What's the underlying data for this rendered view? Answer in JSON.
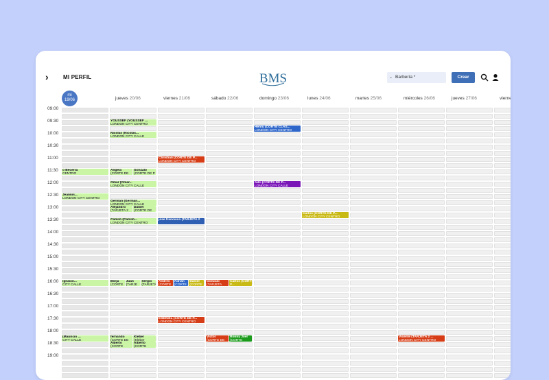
{
  "header": {
    "menu_label": "MI PERFIL",
    "logo_text": "BMS",
    "location_select": "Barbería *",
    "create_button": "Crear"
  },
  "days": [
    {
      "name": "mi",
      "date": "19/06",
      "today": true
    },
    {
      "name": "jueves",
      "date": "20/06"
    },
    {
      "name": "viernes",
      "date": "21/06"
    },
    {
      "name": "sábado",
      "date": "22/06"
    },
    {
      "name": "domingo",
      "date": "23/06"
    },
    {
      "name": "lunes",
      "date": "24/06"
    },
    {
      "name": "martes",
      "date": "25/06"
    },
    {
      "name": "miércoles",
      "date": "26/06"
    },
    {
      "name": "jueves",
      "date": "27/06"
    },
    {
      "name": "viernes",
      "date": ""
    }
  ],
  "times": [
    "09:00",
    "09:30",
    "10:00",
    "10:30",
    "11:00",
    "11:30",
    "12:00",
    "12:30",
    "13:00",
    "13:30",
    "14:00",
    "14:30",
    "15:00",
    "15:30",
    "16:00",
    "16:30",
    "17:00",
    "17:30",
    "18:00",
    "18:30",
    "19:00"
  ],
  "events": [
    {
      "day": 1,
      "slot": 2,
      "part": 0,
      "of": 1,
      "color": "g",
      "title": "YOUSSEF (YOUSSEF ...",
      "sub": "LONDON CITY CENTRO"
    },
    {
      "day": 1,
      "slot": 4,
      "part": 0,
      "of": 1,
      "color": "g",
      "title": "Nicolas (Nicolas...",
      "sub": "LONDON CITY CALLE"
    },
    {
      "day": 0,
      "slot": 10,
      "part": 0,
      "of": 1,
      "color": "g",
      "title": "o Becerra",
      "sub": "CENTRO"
    },
    {
      "day": 1,
      "slot": 10,
      "part": 0,
      "of": 2,
      "color": "g",
      "title": "Angela",
      "sub": "(CORTE DE"
    },
    {
      "day": 1,
      "slot": 10,
      "part": 1,
      "of": 2,
      "color": "g",
      "title": "Gonzalo",
      "sub": "(CORTE DE P"
    },
    {
      "day": 1,
      "slot": 12,
      "part": 0,
      "of": 1,
      "color": "g",
      "title": "Omar (Omar...",
      "sub": "LONDON CITY CALLE"
    },
    {
      "day": 0,
      "slot": 14,
      "part": 0,
      "of": 1,
      "color": "g",
      "title": "Jeannis...",
      "sub": "LONDON CITY CENTRO"
    },
    {
      "day": 1,
      "slot": 15,
      "part": 0,
      "of": 1,
      "color": "g",
      "title": "Germán (Germán...",
      "sub": "LONDON CITY CALLE"
    },
    {
      "day": 1,
      "slot": 16,
      "part": 0,
      "of": 2,
      "color": "g",
      "title": "Alejandro",
      "sub": "(TARJETA 2"
    },
    {
      "day": 1,
      "slot": 16,
      "part": 1,
      "of": 2,
      "color": "g",
      "title": "Daniel",
      "sub": "(CORTE DE"
    },
    {
      "day": 1,
      "slot": 18,
      "part": 0,
      "of": 1,
      "color": "g",
      "title": "Camilo (Camilo...",
      "sub": "LONDON CITY CENTRO"
    },
    {
      "day": 2,
      "slot": 8,
      "part": 0,
      "of": 1,
      "color": "r",
      "title": "Christian (CORTE DE P...",
      "sub": "LONDON CITY CENTRO"
    },
    {
      "day": 2,
      "slot": 18,
      "part": 0,
      "of": 1,
      "color": "b",
      "title": "jose francisco (TARJETA 2",
      "sub": ""
    },
    {
      "day": 4,
      "slot": 3,
      "part": 0,
      "of": 1,
      "color": "lb",
      "title": "Henry (CORTE CLAS...",
      "sub": "LONDON CITY CENTRO"
    },
    {
      "day": 4,
      "slot": 12,
      "part": 0,
      "of": 1,
      "color": "p",
      "title": "Adri (CORTE DE P...",
      "sub": "LONDON CITY CALLE"
    },
    {
      "day": 5,
      "slot": 17,
      "part": 0,
      "of": 1,
      "color": "y",
      "title": "Carlos (CORTE DE P...",
      "sub": "LONDON CITY CENTRO"
    },
    {
      "day": 0,
      "slot": 28,
      "part": 0,
      "of": 1,
      "color": "g",
      "title": "ignacio...",
      "sub": "CITY CALLE"
    },
    {
      "day": 1,
      "slot": 28,
      "part": 0,
      "of": 3,
      "color": "g",
      "title": "Borja",
      "sub": "(CORTE"
    },
    {
      "day": 1,
      "slot": 28,
      "part": 1,
      "of": 3,
      "color": "g",
      "title": "Juan",
      "sub": "(TARJE"
    },
    {
      "day": 1,
      "slot": 28,
      "part": 2,
      "of": 3,
      "color": "g",
      "title": "Sergio",
      "sub": "(TARJETA"
    },
    {
      "day": 2,
      "slot": 28,
      "part": 0,
      "of": 3,
      "color": "r",
      "title": "Andrés",
      "sub": "(CORTE"
    },
    {
      "day": 2,
      "slot": 28,
      "part": 1,
      "of": 3,
      "color": "lb",
      "title": "Adrián",
      "sub": "(CORTE"
    },
    {
      "day": 2,
      "slot": 28,
      "part": 2,
      "of": 3,
      "color": "y",
      "title": "Daniel",
      "sub": "(CORTE"
    },
    {
      "day": 3,
      "slot": 28,
      "part": 0,
      "of": 2,
      "color": "r",
      "title": "Gonzalo",
      "sub": "(TARJETA"
    },
    {
      "day": 3,
      "slot": 28,
      "part": 1,
      "of": 2,
      "color": "y",
      "title": "Carlos (CORTE DE",
      "sub": "P..."
    },
    {
      "day": 2,
      "slot": 34,
      "part": 0,
      "of": 1,
      "color": "r",
      "title": "ESEKIEL (CORTE DE P...",
      "sub": "LONDON CITY CENTRO"
    },
    {
      "day": 0,
      "slot": 37,
      "part": 0,
      "of": 1,
      "color": "g",
      "title": "(Mauricio ...",
      "sub": "CITY CALLE"
    },
    {
      "day": 1,
      "slot": 37,
      "part": 0,
      "of": 2,
      "color": "g",
      "title": "fernando",
      "sub": "(CORTE DE"
    },
    {
      "day": 1,
      "slot": 37,
      "part": 1,
      "of": 2,
      "color": "g",
      "title": "Kleber",
      "sub": "(Kleber"
    },
    {
      "day": 1,
      "slot": 38,
      "part": 0,
      "of": 2,
      "color": "g",
      "title": "Alberto",
      "sub": "(CORTE"
    },
    {
      "day": 1,
      "slot": 38,
      "part": 1,
      "of": 2,
      "color": "g",
      "title": "Alberto",
      "sub": "(CORTE"
    },
    {
      "day": 3,
      "slot": 37,
      "part": 0,
      "of": 2,
      "color": "r",
      "title": "Victor",
      "sub": "(CORTE DE"
    },
    {
      "day": 3,
      "slot": 37,
      "part": 1,
      "of": 2,
      "color": "gr",
      "title": "Ronny Joel",
      "sub": "(CORTE"
    },
    {
      "day": 7,
      "slot": 37,
      "part": 0,
      "of": 1,
      "color": "r",
      "title": "Vicente (TARJETA 2 ...",
      "sub": "LONDON CITY CENTRO"
    }
  ]
}
